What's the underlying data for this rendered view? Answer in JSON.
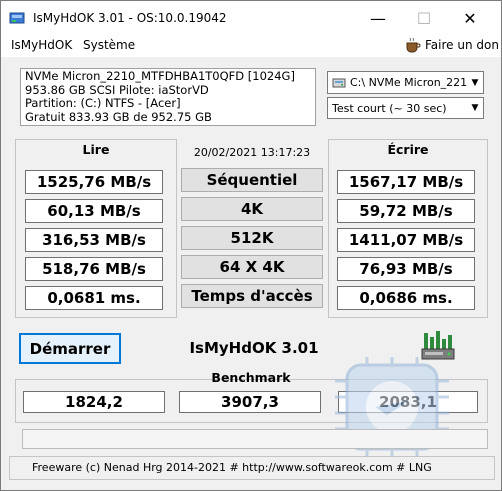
{
  "window": {
    "title": "IsMyHdOK 3.01 - OS:10.0.19042",
    "controls": {
      "minimize": "—",
      "maximize": "☐",
      "close": "✕"
    }
  },
  "menu": {
    "items": [
      "IsMyHdOK",
      "Système"
    ],
    "coffee_label": "Faire un don"
  },
  "drive_info": {
    "lines": [
      "NVMe Micron_2210_MTFDHBA1T0QFD [1024G]",
      "953.86 GB  SCSI Pilote: iaStorVD",
      "Partition: (C:) NTFS - [Acer]",
      "Gratuit 833.93 GB de 952.75 GB"
    ],
    "drive_select": "C:\\ NVMe Micron_2210_",
    "test_select": "Test court (~ 30 sec)"
  },
  "results": {
    "read_header": "Lire",
    "write_header": "Écrire",
    "timestamp": "20/02/2021 13:17:23",
    "tests": [
      "Séquentiel",
      "4K",
      "512K",
      "64 X 4K",
      "Temps d'accès"
    ],
    "read": [
      "1525,76 MB/s",
      "60,13 MB/s",
      "316,53 MB/s",
      "518,76 MB/s",
      "0,0681 ms."
    ],
    "write": [
      "1567,17 MB/s",
      "59,72 MB/s",
      "1411,07 MB/s",
      "76,93 MB/s",
      "0,0686 ms."
    ]
  },
  "start_button": "Démarrer",
  "app_name": "IsMyHdOK 3.01",
  "benchmark": {
    "header": "Benchmark",
    "values": [
      "1824,2",
      "3907,3",
      "2083,1"
    ]
  },
  "progress": {
    "percent": 0
  },
  "footer": "Freeware (c) Nenad Hrg 2014-2021 # http://www.softwareok.com      # LNG",
  "colors": {
    "accent": "#0078d7",
    "start_bg": "#e5f1fb"
  }
}
